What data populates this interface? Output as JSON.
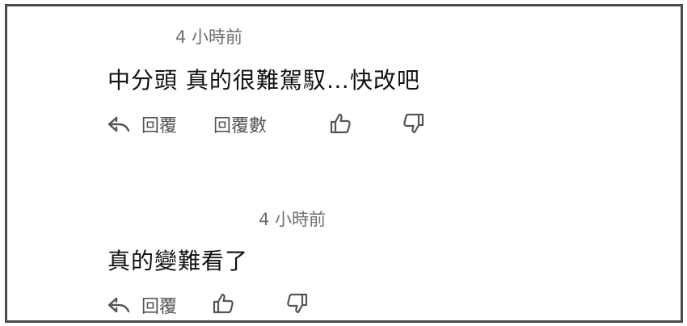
{
  "comments": [
    {
      "timestamp": "4 小時前",
      "text": "中分頭 真的很難駕馭…快改吧",
      "reply_label": "回覆",
      "replies_label": "回覆數"
    },
    {
      "timestamp": "4 小時前",
      "text": "真的變難看了",
      "reply_label": "回覆"
    }
  ],
  "icons": {
    "reply": "reply-arrow-icon",
    "like": "thumbs-up-icon",
    "dislike": "thumbs-down-icon"
  },
  "colors": {
    "border": "#4a4a4a",
    "text": "#111111",
    "muted": "#6f6f6f",
    "icon": "#555555"
  }
}
